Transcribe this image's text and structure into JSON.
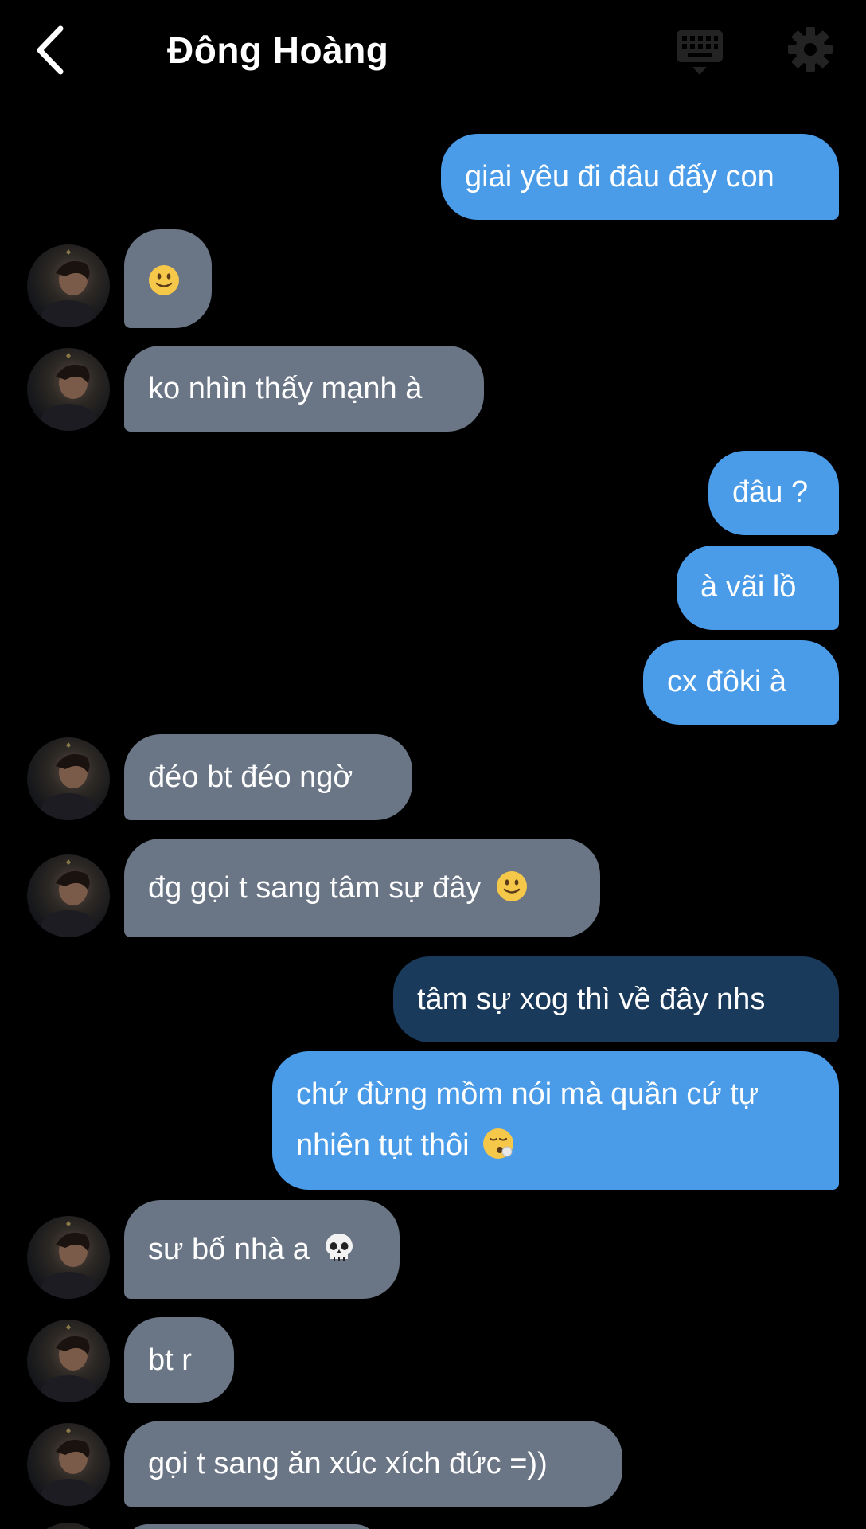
{
  "header": {
    "title": "Đông Hoàng"
  },
  "colors": {
    "sent_bubble": "#4a9be8",
    "sent_bubble_pressed": "#1a3a5c",
    "received_bubble": "#6a7585",
    "background": "#000000"
  },
  "icons": {
    "back": "chevron-left-icon",
    "keyboard": "keyboard-icon",
    "settings": "gear-icon",
    "smile_emoji": "slightly-smiling-face",
    "skull_emoji": "skull",
    "sigh_emoji": "face-exhaling"
  },
  "messages": [
    {
      "from": "me",
      "text": "giai yêu đi đâu đấy con"
    },
    {
      "from": "them",
      "emoji": "slightly-smiling-face"
    },
    {
      "from": "them",
      "text": "ko nhìn thấy mạnh à"
    },
    {
      "from": "me",
      "text": "đâu ?"
    },
    {
      "from": "me",
      "text": "à vãi lồ"
    },
    {
      "from": "me",
      "text": "cx đôki à"
    },
    {
      "from": "them",
      "text": "đéo bt đéo ngờ"
    },
    {
      "from": "them",
      "text": "đg gọi t sang tâm sự đây",
      "emoji": "slightly-smiling-face"
    },
    {
      "from": "me",
      "text": "tâm sự xog thì về đây nhs",
      "state": "pressed"
    },
    {
      "from": "me",
      "text": "chứ đừng mồm nói mà quần cứ tự nhiên tụt thôi",
      "emoji": "face-exhaling"
    },
    {
      "from": "them",
      "text": "sư bố nhà a",
      "emoji": "skull"
    },
    {
      "from": "them",
      "text": "bt r"
    },
    {
      "from": "them",
      "text": "gọi t sang ăn xúc xích đức =))"
    }
  ]
}
